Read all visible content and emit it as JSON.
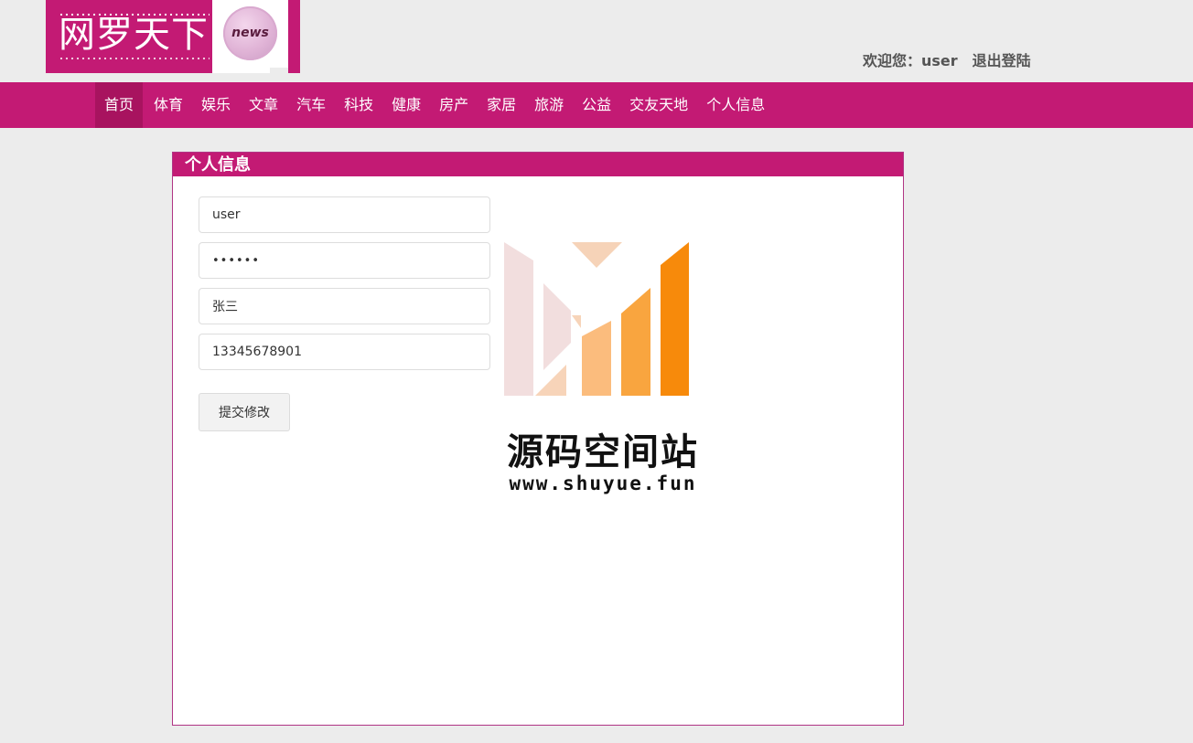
{
  "header": {
    "logo_text": "网罗天下",
    "badge_text": "news",
    "welcome_prefix": "欢迎您：",
    "username": "user",
    "logout_label": "退出登陆"
  },
  "nav": {
    "items": [
      {
        "label": "首页",
        "active": true
      },
      {
        "label": "体育"
      },
      {
        "label": "娱乐"
      },
      {
        "label": "文章"
      },
      {
        "label": "汽车"
      },
      {
        "label": "科技"
      },
      {
        "label": "健康"
      },
      {
        "label": "房产"
      },
      {
        "label": "家居"
      },
      {
        "label": "旅游"
      },
      {
        "label": "公益"
      },
      {
        "label": "交友天地"
      },
      {
        "label": "个人信息"
      }
    ]
  },
  "profile": {
    "title": "个人信息",
    "username_value": "user",
    "password_value": "••••••",
    "name_value": "张三",
    "phone_value": "13345678901",
    "submit_label": "提交修改"
  },
  "watermark": {
    "title": "源码空间站",
    "url": "www.shuyue.fun"
  },
  "colors": {
    "brand": "#c31a74",
    "background": "#ececec",
    "panel": "#ffffff",
    "watermark_orange": "#f78a0b"
  }
}
